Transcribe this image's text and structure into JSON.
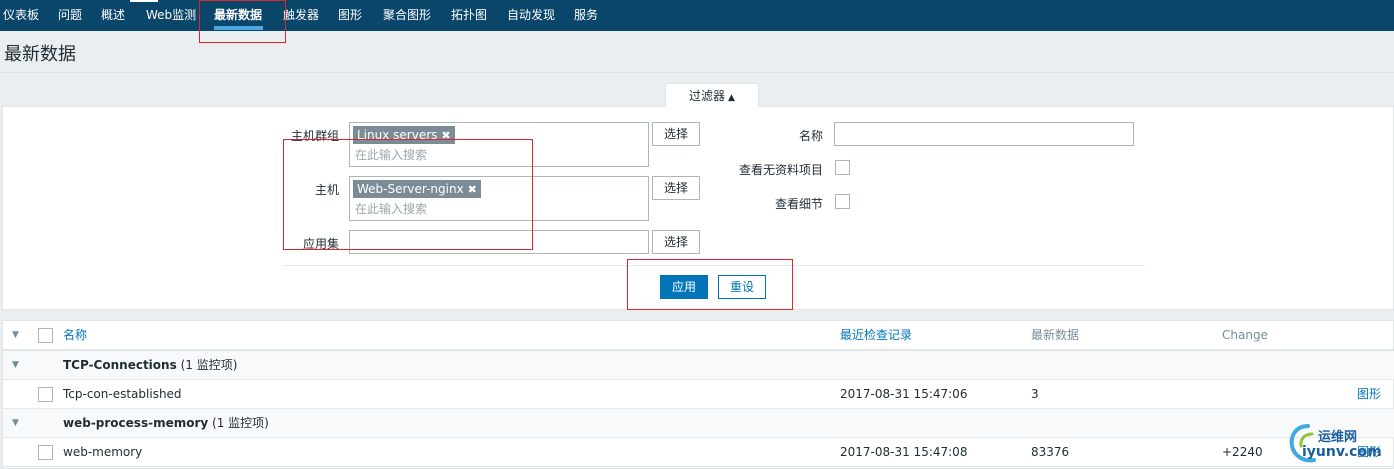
{
  "nav": {
    "items": [
      "仪表板",
      "问题",
      "概述",
      "Web监测",
      "最新数据",
      "触发器",
      "图形",
      "聚合图形",
      "拓扑图",
      "自动发现",
      "服务"
    ],
    "active": "最新数据"
  },
  "page": {
    "title": "最新数据"
  },
  "filter": {
    "tab_label": "过滤器",
    "tab_arrow": "▲",
    "host_groups": {
      "label": "主机群组",
      "chip": "Linux servers",
      "placeholder": "在此输入搜索",
      "select_label": "选择"
    },
    "hosts": {
      "label": "主机",
      "chip": "Web-Server-nginx",
      "placeholder": "在此输入搜索",
      "select_label": "选择"
    },
    "application": {
      "label": "应用集",
      "value": "",
      "select_label": "选择"
    },
    "name": {
      "label": "名称",
      "value": ""
    },
    "show_without_data": {
      "label": "查看无资料项目",
      "checked": false
    },
    "show_details": {
      "label": "查看细节",
      "checked": false
    },
    "apply_label": "应用",
    "reset_label": "重设"
  },
  "table": {
    "headers": {
      "name": "名称",
      "last_check": "最近检查记录",
      "last_value": "最新数据",
      "change": "Change"
    },
    "groups": [
      {
        "name": "TCP-Connections",
        "count": "(1 监控项)",
        "items": [
          {
            "name": "Tcp-con-established",
            "last_check": "2017-08-31 15:47:06",
            "last_value": "3",
            "change": "",
            "action": "图形"
          }
        ]
      },
      {
        "name": "web-process-memory",
        "count": "(1 监控项)",
        "items": [
          {
            "name": "web-memory",
            "last_check": "2017-08-31 15:47:08",
            "last_value": "83376",
            "change": "+2240",
            "action": "图形"
          }
        ]
      }
    ]
  },
  "watermark": {
    "line1": "运维网",
    "line2": "iyunv.com"
  },
  "colors": {
    "nav_bg": "#0a466a",
    "accent": "#0275b8",
    "annotation": "#d9282d"
  }
}
